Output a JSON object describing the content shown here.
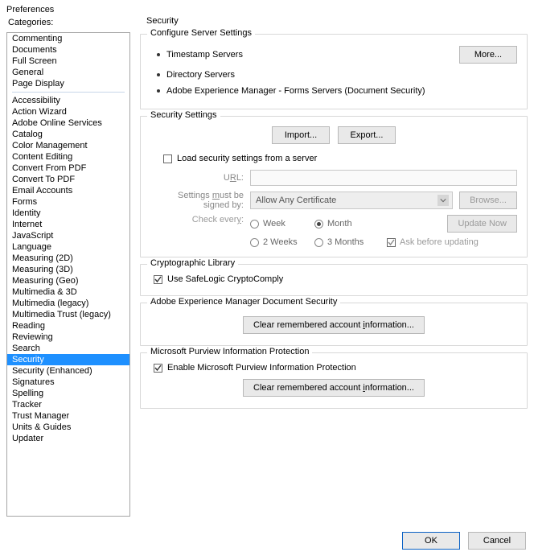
{
  "window": {
    "title": "Preferences"
  },
  "sidebar": {
    "label": "Categories:",
    "groups": [
      [
        "Commenting",
        "Documents",
        "Full Screen",
        "General",
        "Page Display"
      ],
      [
        "Accessibility",
        "Action Wizard",
        "Adobe Online Services",
        "Catalog",
        "Color Management",
        "Content Editing",
        "Convert From PDF",
        "Convert To PDF",
        "Email Accounts",
        "Forms",
        "Identity",
        "Internet",
        "JavaScript",
        "Language",
        "Measuring (2D)",
        "Measuring (3D)",
        "Measuring (Geo)",
        "Multimedia & 3D",
        "Multimedia (legacy)",
        "Multimedia Trust (legacy)",
        "Reading",
        "Reviewing",
        "Search",
        "Security",
        "Security (Enhanced)",
        "Signatures",
        "Spelling",
        "Tracker",
        "Trust Manager",
        "Units & Guides",
        "Updater"
      ]
    ],
    "selected": "Security"
  },
  "panel": {
    "title": "Security",
    "server": {
      "title": "Configure Server Settings",
      "items": [
        "Timestamp Servers",
        "Directory Servers",
        "Adobe Experience Manager - Forms Servers (Document Security)"
      ],
      "more": "More..."
    },
    "settings": {
      "title": "Security Settings",
      "import": "Import...",
      "export": "Export...",
      "load_label": "Load security settings from a server",
      "load_checked": false,
      "url_label": "URL:",
      "url_value": "",
      "signed_label": "Settings must be signed by:",
      "signed_value": "Allow Any Certificate",
      "browse": "Browse...",
      "check_label": "Check every:",
      "update_now": "Update Now",
      "radios": {
        "week": {
          "label": "Week",
          "on": false
        },
        "month": {
          "label": "Month",
          "on": true
        },
        "two_weeks": {
          "label": "2 Weeks",
          "on": false
        },
        "three_months": {
          "label": "3 Months",
          "on": false
        }
      },
      "ask_label": "Ask before updating",
      "ask_checked": true
    },
    "crypto": {
      "title": "Cryptographic Library",
      "use_label": "Use SafeLogic CryptoComply",
      "use_checked": true
    },
    "aem": {
      "title": "Adobe Experience Manager Document Security",
      "clear": "Clear remembered account information..."
    },
    "purview": {
      "title": "Microsoft Purview Information Protection",
      "enable_label": "Enable Microsoft Purview Information Protection",
      "enable_checked": true,
      "clear": "Clear remembered account information..."
    }
  },
  "footer": {
    "ok": "OK",
    "cancel": "Cancel"
  }
}
